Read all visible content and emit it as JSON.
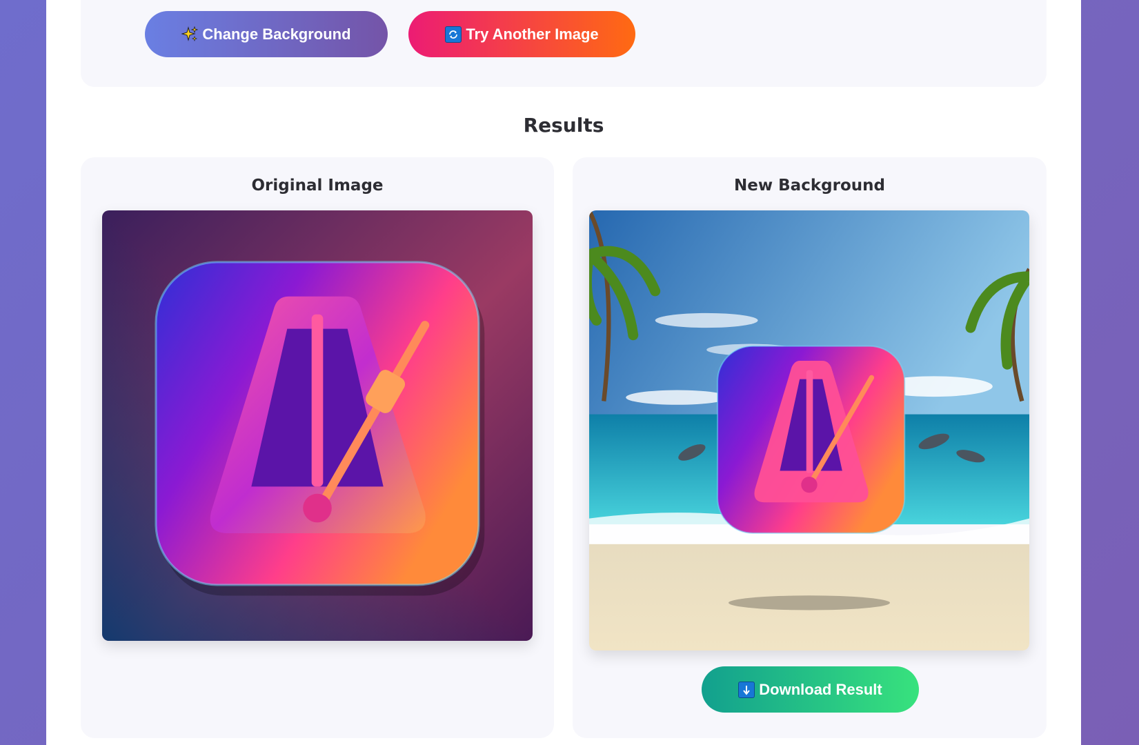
{
  "controls": {
    "change_background_label": "Change Background",
    "try_another_label": "Try Another Image"
  },
  "results": {
    "title": "Results",
    "original_title": "Original Image",
    "new_title": "New Background",
    "download_label": "Download Result"
  },
  "icons": {
    "change_background": "sparkles-icon",
    "try_another": "refresh-icon",
    "download": "download-arrow-icon"
  },
  "colors": {
    "page_background": "#7366c2",
    "change_button": "#6a7fe3",
    "try_button": "#ec1c74",
    "download_button": "#1fb48a"
  }
}
